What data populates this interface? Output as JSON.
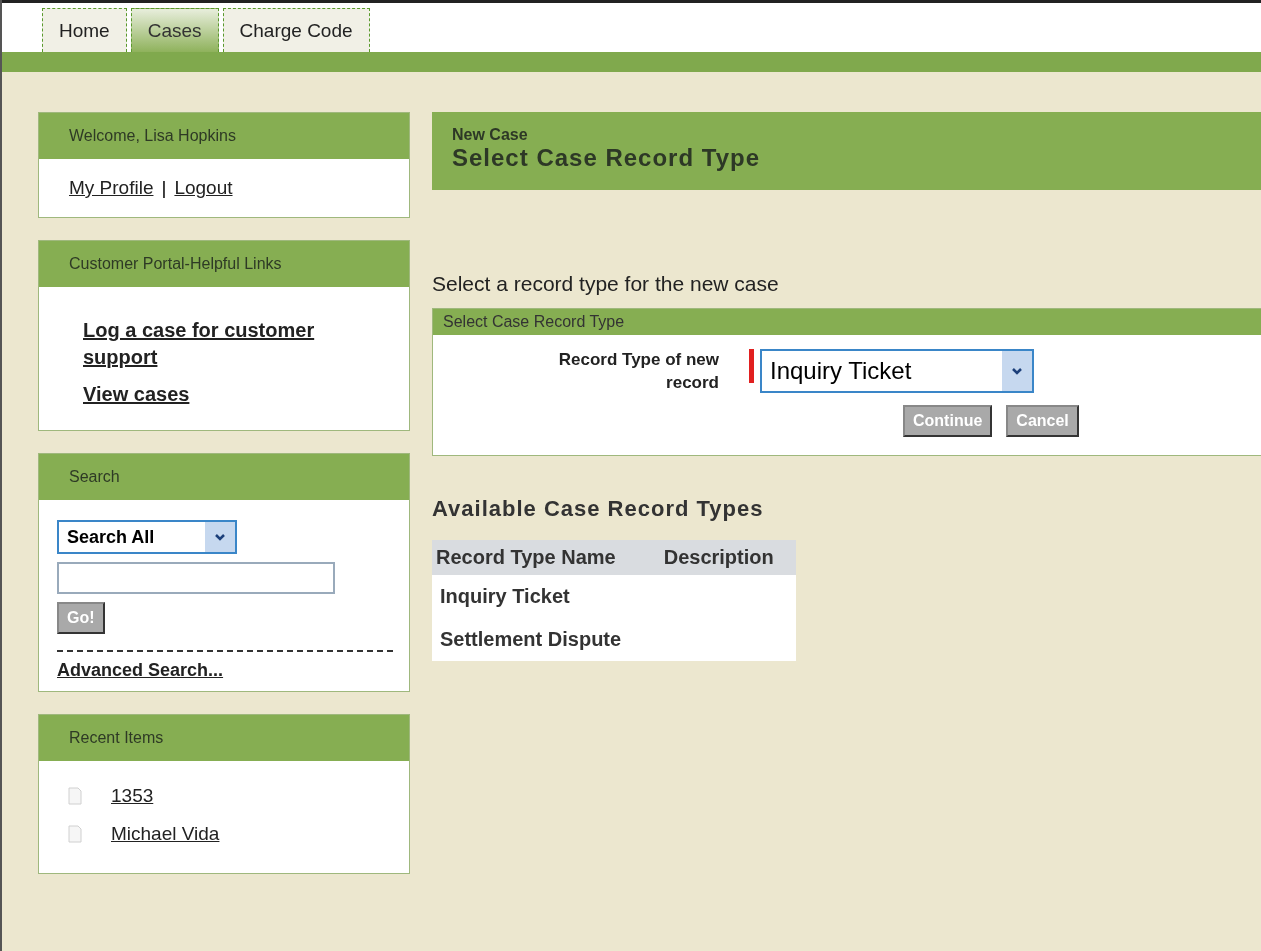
{
  "tabs": [
    {
      "label": "Home",
      "selected": false
    },
    {
      "label": "Cases",
      "selected": true
    },
    {
      "label": "Charge Code",
      "selected": false
    }
  ],
  "welcome": {
    "title": "Welcome, Lisa Hopkins",
    "links": [
      "My Profile",
      "Logout"
    ],
    "separator": "|"
  },
  "helpful_links": {
    "title": "Customer Portal-Helpful Links",
    "links": [
      "Log a case for customer support",
      "View cases"
    ]
  },
  "search": {
    "title": "Search",
    "scope": "Search All",
    "button": "Go!",
    "advanced": "Advanced Search..."
  },
  "recent_items": {
    "title": "Recent Items",
    "items": [
      "1353",
      "Michael Vida"
    ]
  },
  "page_header": {
    "subtitle": "New Case",
    "title": "Select Case Record Type"
  },
  "instruction": "Select a record type for the new case",
  "form": {
    "title": "Select Case Record Type",
    "field_label": "Record Type of new record",
    "required": true,
    "value": "Inquiry Ticket",
    "buttons": [
      "Continue",
      "Cancel"
    ]
  },
  "available": {
    "title": "Available Case Record Types",
    "columns": [
      "Record Type Name",
      "Description"
    ],
    "rows": [
      [
        "Inquiry Ticket",
        ""
      ],
      [
        "Settlement Dispute",
        ""
      ]
    ]
  }
}
